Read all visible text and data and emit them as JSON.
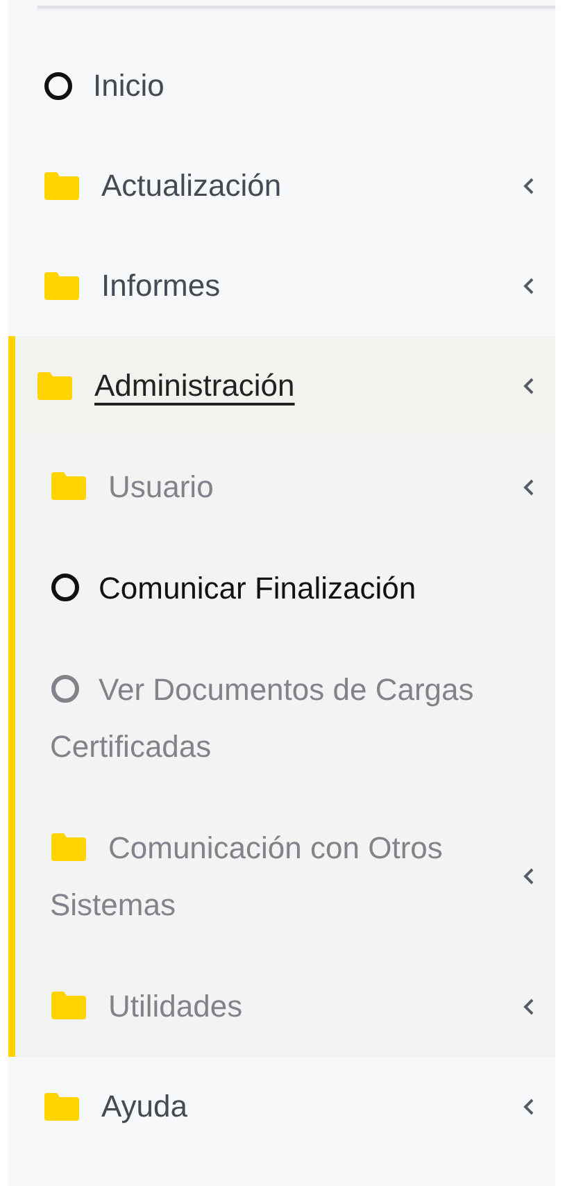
{
  "menu": [
    {
      "kind": "link",
      "label": "Inicio",
      "selected": false
    },
    {
      "kind": "folder",
      "label": "Actualización",
      "selected": false
    },
    {
      "kind": "folder",
      "label": "Informes",
      "selected": false
    },
    {
      "kind": "folder",
      "label": "Administración",
      "selected": true,
      "children": [
        {
          "kind": "folder",
          "label": "Usuario",
          "active": false
        },
        {
          "kind": "link",
          "label": "Comunicar Finalización",
          "active": true
        },
        {
          "kind": "link",
          "label": "Ver Documentos de Cargas Certificadas",
          "active": false
        },
        {
          "kind": "folder",
          "label": "Comunicación con Otros Sistemas",
          "active": false
        },
        {
          "kind": "folder",
          "label": "Utilidades",
          "active": false
        }
      ]
    },
    {
      "kind": "folder",
      "label": "Ayuda",
      "selected": false
    }
  ]
}
